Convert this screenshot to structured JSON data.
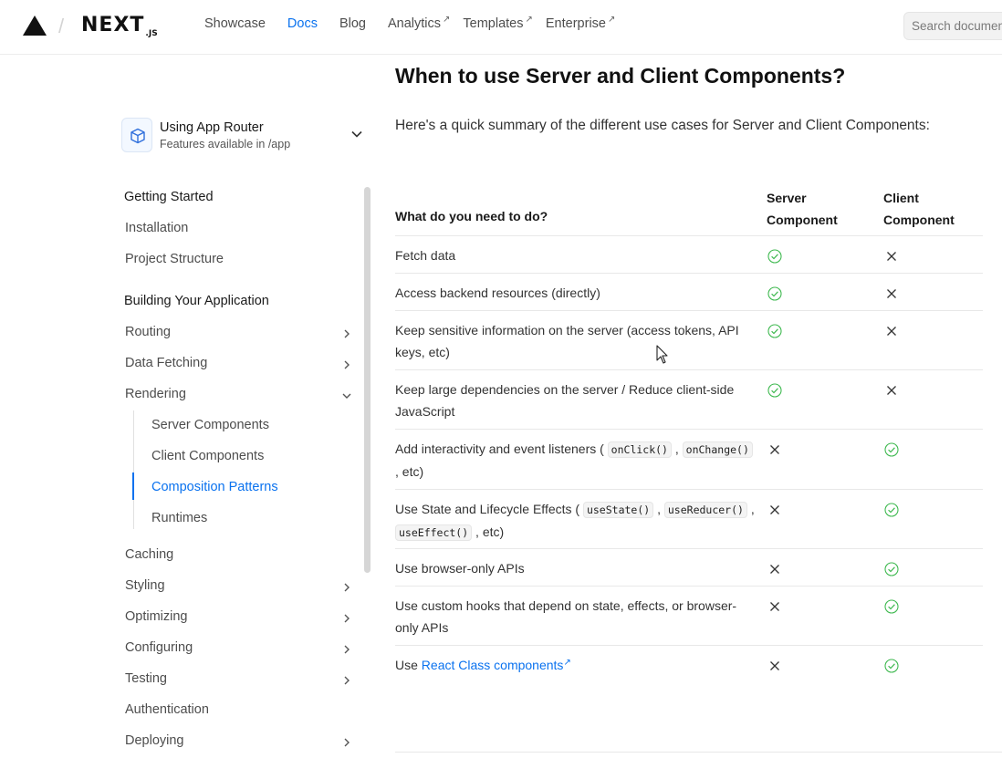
{
  "nav": {
    "brand": "NEXT",
    "brand_suffix": ".JS",
    "links": [
      {
        "label": "Showcase",
        "external": false,
        "active": false
      },
      {
        "label": "Docs",
        "external": false,
        "active": true
      },
      {
        "label": "Blog",
        "external": false,
        "active": false
      },
      {
        "label": "Analytics",
        "external": true,
        "active": false
      },
      {
        "label": "Templates",
        "external": true,
        "active": false
      },
      {
        "label": "Enterprise",
        "external": true,
        "active": false
      }
    ],
    "external_glyph": "↗",
    "search_placeholder": "Search documentation..."
  },
  "sidebar": {
    "router_title": "Using App Router",
    "router_subtitle": "Features available in /app",
    "items": [
      {
        "label": "Getting Started",
        "kind": "section",
        "chevron": "none"
      },
      {
        "label": "Installation",
        "kind": "item",
        "chevron": "none"
      },
      {
        "label": "Project Structure",
        "kind": "item",
        "chevron": "none"
      },
      {
        "label": "Building Your Application",
        "kind": "section",
        "chevron": "none"
      },
      {
        "label": "Routing",
        "kind": "item",
        "chevron": "right"
      },
      {
        "label": "Data Fetching",
        "kind": "item",
        "chevron": "right"
      },
      {
        "label": "Rendering",
        "kind": "item",
        "chevron": "down"
      },
      {
        "label": "Server Components",
        "kind": "sub",
        "chevron": "none"
      },
      {
        "label": "Client Components",
        "kind": "sub",
        "chevron": "none"
      },
      {
        "label": "Composition Patterns",
        "kind": "sub",
        "chevron": "none",
        "active": true
      },
      {
        "label": "Runtimes",
        "kind": "sub",
        "chevron": "none"
      },
      {
        "label": "Caching",
        "kind": "item",
        "chevron": "none"
      },
      {
        "label": "Styling",
        "kind": "item",
        "chevron": "right"
      },
      {
        "label": "Optimizing",
        "kind": "item",
        "chevron": "right"
      },
      {
        "label": "Configuring",
        "kind": "item",
        "chevron": "right"
      },
      {
        "label": "Testing",
        "kind": "item",
        "chevron": "right"
      },
      {
        "label": "Authentication",
        "kind": "item",
        "chevron": "none"
      },
      {
        "label": "Deploying",
        "kind": "item",
        "chevron": "right"
      }
    ]
  },
  "main": {
    "title": "When to use Server and Client Components?",
    "intro": "Here's a quick summary of the different use cases for Server and Client Components:",
    "table": {
      "col_task": "What do you need to do?",
      "col_server_1": "Server",
      "col_server_2": "Component",
      "col_client_1": "Client",
      "col_client_2": "Component",
      "rows": [
        {
          "parts": [
            {
              "t": "Fetch data"
            }
          ],
          "server": true,
          "client": false
        },
        {
          "parts": [
            {
              "t": "Access backend resources (directly)"
            }
          ],
          "server": true,
          "client": false
        },
        {
          "parts": [
            {
              "t": "Keep sensitive information on the server (access tokens, API keys, etc)"
            }
          ],
          "server": true,
          "client": false
        },
        {
          "parts": [
            {
              "t": "Keep large dependencies on the server / Reduce client-side JavaScript"
            }
          ],
          "server": true,
          "client": false
        },
        {
          "parts": [
            {
              "t": "Add interactivity and event listeners ( "
            },
            {
              "c": "onClick()"
            },
            {
              "t": " , "
            },
            {
              "c": "onChange()"
            },
            {
              "t": " , etc)"
            }
          ],
          "server": false,
          "client": true
        },
        {
          "parts": [
            {
              "t": "Use State and Lifecycle Effects ( "
            },
            {
              "c": "useState()"
            },
            {
              "t": " , "
            },
            {
              "c": "useReducer()"
            },
            {
              "t": " , "
            },
            {
              "c": "useEffect()"
            },
            {
              "t": " , etc)"
            }
          ],
          "server": false,
          "client": true
        },
        {
          "parts": [
            {
              "t": "Use browser-only APIs"
            }
          ],
          "server": false,
          "client": true
        },
        {
          "parts": [
            {
              "t": "Use custom hooks that depend on state, effects, or browser-only APIs"
            }
          ],
          "server": false,
          "client": true
        },
        {
          "parts": [
            {
              "t": "Use "
            },
            {
              "l": "React Class components"
            }
          ],
          "server": false,
          "client": true
        }
      ]
    }
  },
  "colors": {
    "accent": "#0a72ef",
    "check": "#3fb950",
    "cross": "#333333"
  }
}
